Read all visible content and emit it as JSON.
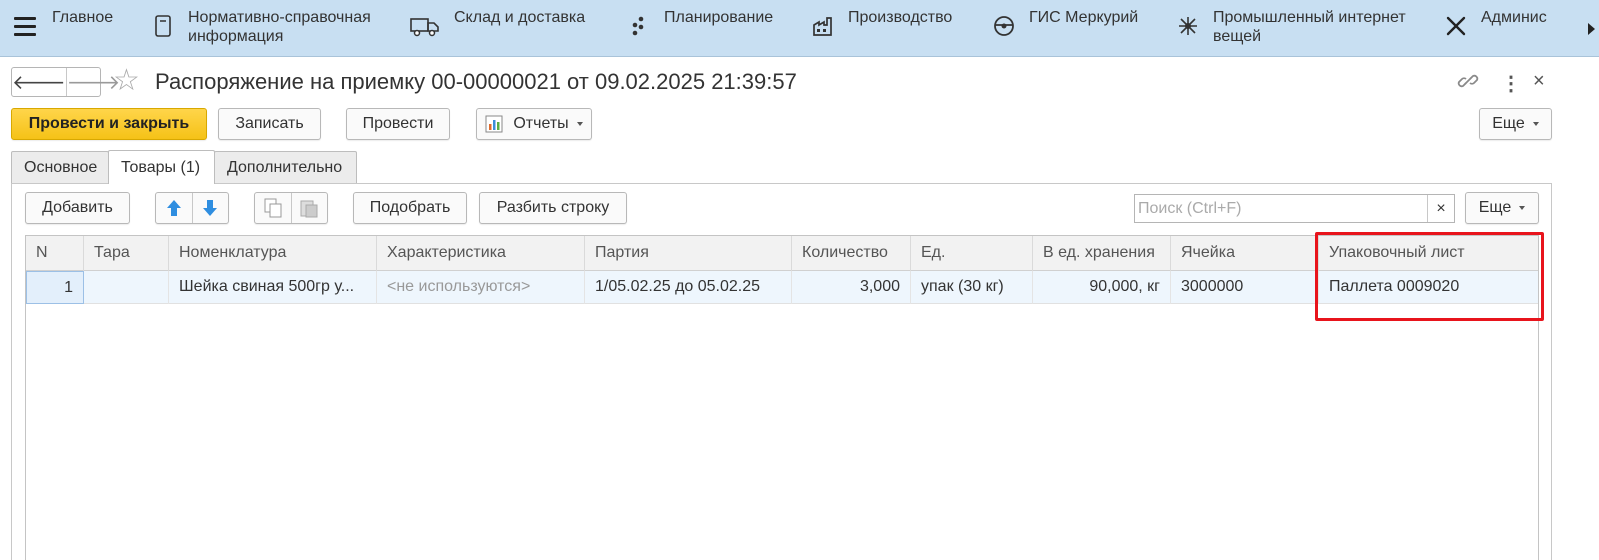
{
  "topnav": {
    "items": [
      {
        "label": "Главное",
        "icon": "home-icon"
      },
      {
        "label": "Нормативно-справочная\nинформация",
        "icon": "book-icon"
      },
      {
        "label": "Склад и доставка",
        "icon": "truck-icon"
      },
      {
        "label": "Планирование",
        "icon": "dots-icon"
      },
      {
        "label": "Производство",
        "icon": "factory-icon"
      },
      {
        "label": "ГИС Меркурий",
        "icon": "steering-icon"
      },
      {
        "label": "Промышленный интернет\nвещей",
        "icon": "network-icon"
      },
      {
        "label": "Админис",
        "icon": "tools-icon"
      }
    ]
  },
  "header": {
    "title": "Распоряжение на приемку 00-00000021 от 09.02.2025 21:39:57"
  },
  "toolbar": {
    "post_close": "Провести и закрыть",
    "save": "Записать",
    "post": "Провести",
    "reports": "Отчеты",
    "more": "Еще"
  },
  "tabs": [
    {
      "label": "Основное",
      "active": false
    },
    {
      "label": "Товары (1)",
      "active": true
    },
    {
      "label": "Дополнительно",
      "active": false
    }
  ],
  "table_toolbar": {
    "add": "Добавить",
    "select": "Подобрать",
    "split": "Разбить строку",
    "search_placeholder": "Поиск (Ctrl+F)",
    "clear": "×",
    "more": "Еще"
  },
  "table": {
    "columns": [
      "N",
      "Тара",
      "Номенклатура",
      "Характеристика",
      "Партия",
      "Количество",
      "Ед.",
      "В ед. хранения",
      "Ячейка",
      "Упаковочный лист"
    ],
    "rows": [
      [
        "1",
        "",
        "Шейка свиная 500гр у...",
        "<не используются>",
        "1/05.02.25 до 05.02.25",
        "3,000",
        "упак (30 кг)",
        "90,000, кг",
        "3000000",
        "Паллета 0009020"
      ]
    ]
  },
  "colors": {
    "nav_bg": "#c8dff2",
    "primary": "#f5c217",
    "highlight": "#e8141c"
  }
}
